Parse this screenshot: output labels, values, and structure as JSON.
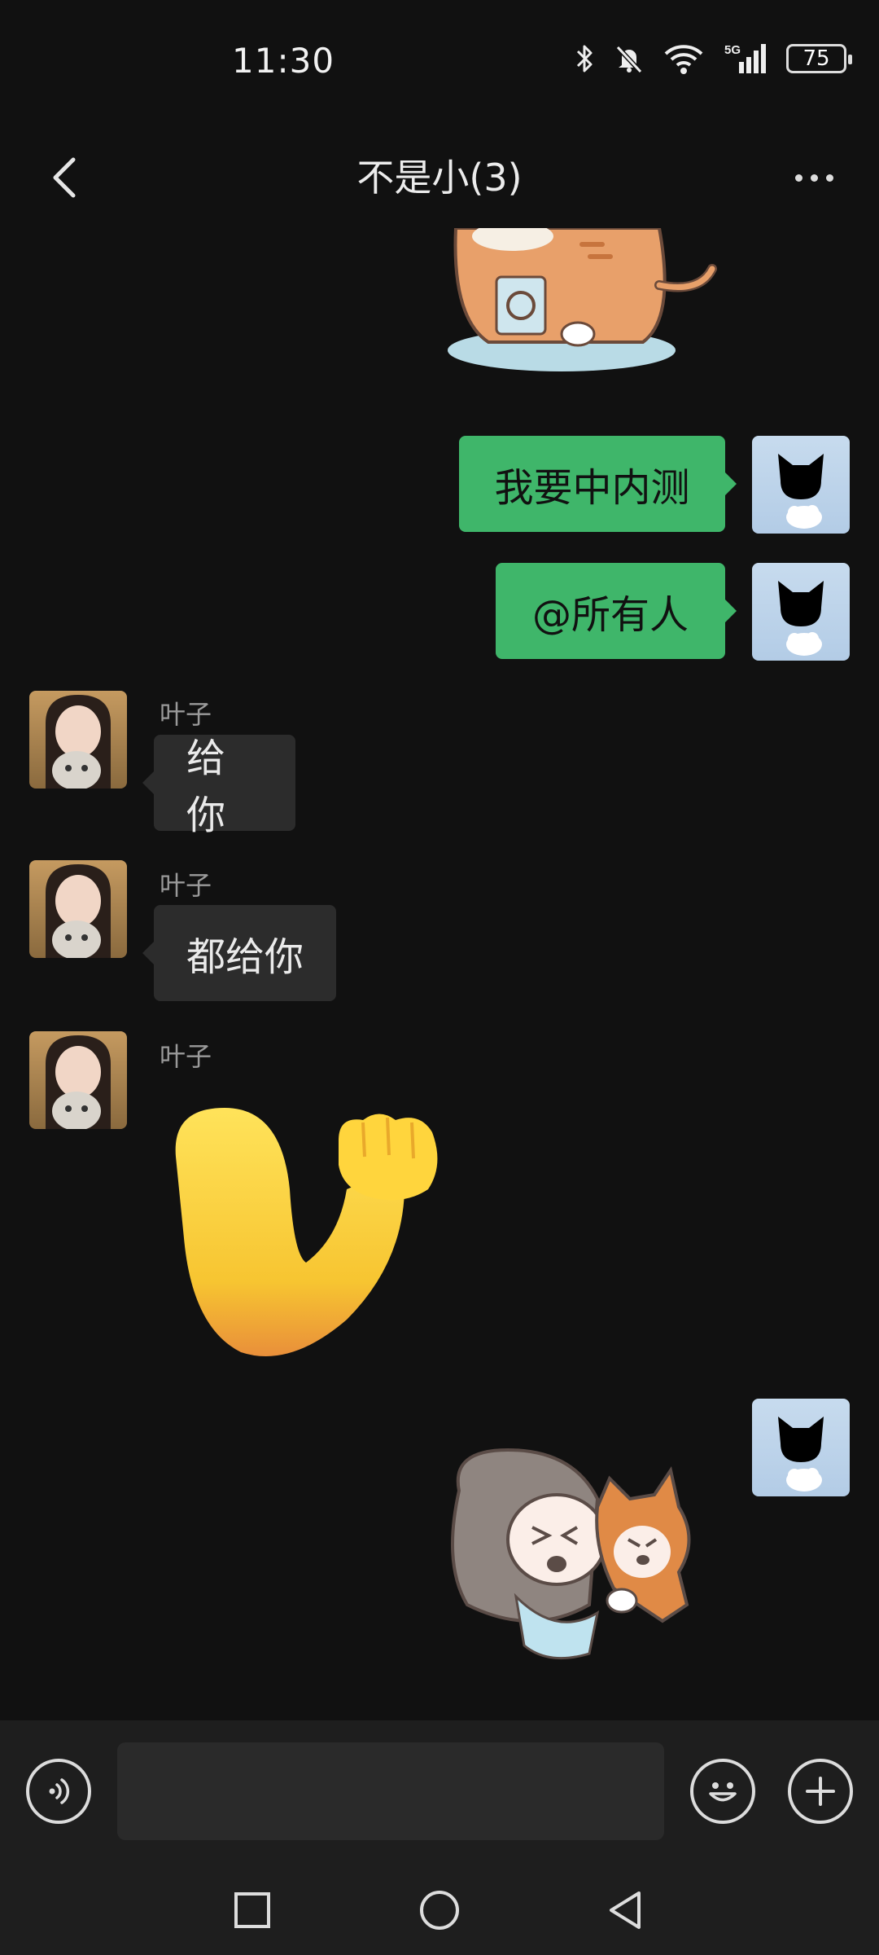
{
  "status_bar": {
    "time": "11:30",
    "battery": "75",
    "network": "5G",
    "icons": [
      "bluetooth-icon",
      "mute-icon",
      "wifi-icon",
      "5g-signal-icon",
      "battery-icon"
    ]
  },
  "header": {
    "title": "不是小(3)",
    "back_icon": "back-arrow-icon",
    "more_icon": "more-options-icon"
  },
  "messages": [
    {
      "type": "sticker",
      "direction": "out",
      "sticker": "cat-sticker"
    },
    {
      "type": "text",
      "direction": "out",
      "text": "我要中内测"
    },
    {
      "type": "text",
      "direction": "out",
      "text": "@所有人"
    },
    {
      "type": "text",
      "direction": "in",
      "sender": "叶子",
      "text": "给你"
    },
    {
      "type": "text",
      "direction": "in",
      "sender": "叶子",
      "text": "都给你"
    },
    {
      "type": "sticker",
      "direction": "in",
      "sender": "叶子",
      "sticker": "flexed-biceps-sticker"
    },
    {
      "type": "sticker",
      "direction": "out",
      "sticker": "girl-hugging-dog-sticker"
    }
  ],
  "input_bar": {
    "voice_icon": "voice-input-icon",
    "placeholder": "",
    "emoji_icon": "emoji-icon",
    "plus_icon": "add-icon"
  },
  "nav_bar": {
    "icons": [
      "recent-apps-icon",
      "home-icon",
      "back-icon"
    ]
  },
  "colors": {
    "background": "#111111",
    "outgoing_bubble": "#3fb66a",
    "incoming_bubble": "#2c2c2c",
    "bar_background": "#1e1e1e"
  }
}
